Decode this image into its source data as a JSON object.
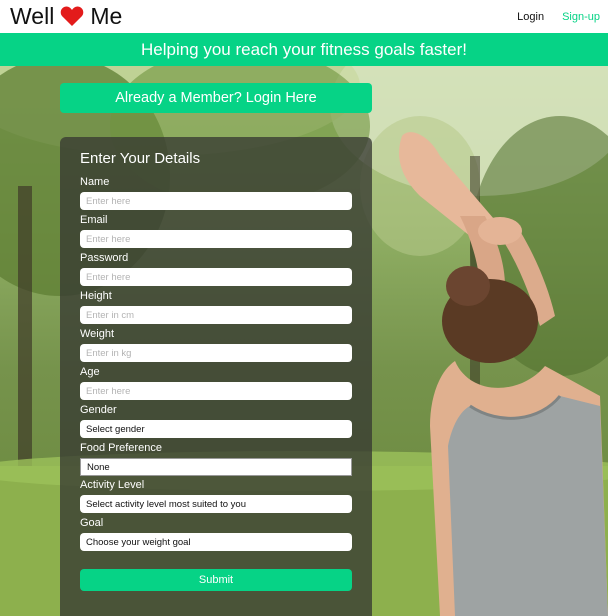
{
  "nav": {
    "brand_left": "Well",
    "brand_icon": "heart-icon",
    "brand_icon_color": "#e31b1b",
    "brand_right": "Me",
    "login_label": "Login",
    "signup_label": "Sign-up"
  },
  "banner": {
    "text": "Helping you reach your fitness goals faster!"
  },
  "member": {
    "label": "Already a Member? Login Here"
  },
  "form": {
    "title": "Enter Your Details",
    "fields": [
      {
        "label": "Name",
        "placeholder": "Enter here"
      },
      {
        "label": "Email",
        "placeholder": "Enter here"
      },
      {
        "label": "Password",
        "placeholder": "Enter here"
      },
      {
        "label": "Height",
        "placeholder": "Enter in cm"
      },
      {
        "label": "Weight",
        "placeholder": "Enter in kg"
      },
      {
        "label": "Age",
        "placeholder": "Enter here"
      }
    ],
    "selects": [
      {
        "label": "Gender",
        "value": "Select gender"
      },
      {
        "label": "Food Preference",
        "value": "None"
      },
      {
        "label": "Activity Level",
        "value": "Select activity level most suited to you"
      },
      {
        "label": "Goal",
        "value": "Choose your weight goal"
      }
    ],
    "submit_label": "Submit"
  },
  "colors": {
    "accent": "#06d386",
    "card_bg": "rgba(55,58,50,0.78)"
  }
}
